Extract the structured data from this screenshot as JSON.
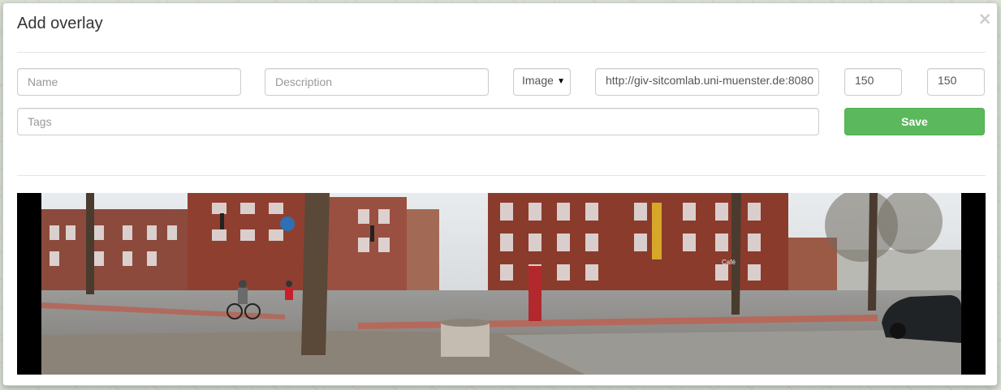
{
  "modal": {
    "title": "Add overlay",
    "close_label": "×"
  },
  "form": {
    "name": {
      "placeholder": "Name",
      "value": ""
    },
    "description": {
      "placeholder": "Description",
      "value": ""
    },
    "type_select": {
      "selected": "Image"
    },
    "url": {
      "value": "http://giv-sitcomlab.uni-muenster.de:8080"
    },
    "width": {
      "value": "150"
    },
    "height": {
      "value": "150"
    },
    "tags": {
      "placeholder": "Tags",
      "value": ""
    },
    "save_label": "Save"
  },
  "colors": {
    "save_button": "#5cb85c",
    "border": "#cccccc"
  },
  "preview": {
    "kind": "panorama-street-photo",
    "shop_sign": "Café"
  }
}
